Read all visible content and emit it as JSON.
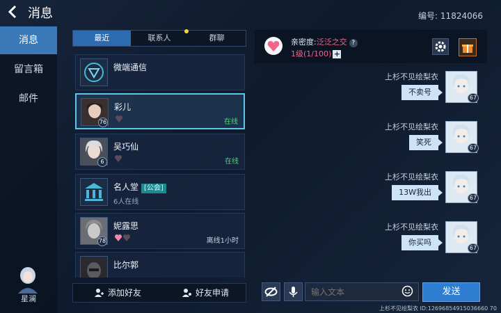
{
  "header": {
    "title": "消息",
    "uid_label": "编号:",
    "uid_value": "11824066"
  },
  "nav": {
    "items": [
      "消息",
      "留言箱",
      "邮件"
    ],
    "me_name": "星澜"
  },
  "tabs": [
    "最近",
    "联系人",
    "群聊"
  ],
  "contacts": [
    {
      "name": "微端通信",
      "sub": "",
      "status": "",
      "level": ""
    },
    {
      "name": "彩儿",
      "sub": "",
      "status": "在线",
      "level": "76"
    },
    {
      "name": "吴巧仙",
      "sub": "",
      "status": "在线",
      "level": "6"
    },
    {
      "name": "名人堂",
      "tag": "[公会]",
      "sub": "6人在线",
      "status": "",
      "level": ""
    },
    {
      "name": "妮露思",
      "sub": "",
      "status": "离线1小时",
      "level": "78"
    },
    {
      "name": "比尔郭",
      "sub": "",
      "status": "",
      "level": ""
    }
  ],
  "bottom_buttons": {
    "add_friend": "添加好友",
    "friend_request": "好友申请"
  },
  "intimacy": {
    "label": "亲密度:",
    "value": "泛泛之交",
    "help": "?",
    "level": "1级(1/100)",
    "plus": "+"
  },
  "messages": [
    {
      "sender": "上杉不见绘梨衣",
      "text": "不卖号",
      "level": "67"
    },
    {
      "sender": "上杉不见绘梨衣",
      "text": "笑死",
      "level": "67"
    },
    {
      "sender": "上杉不见绘梨衣",
      "text": "13W我出",
      "level": "67"
    },
    {
      "sender": "上杉不见绘梨衣",
      "text": "你买吗",
      "level": "67"
    }
  ],
  "input": {
    "placeholder": "输入文本",
    "send_label": "发送"
  },
  "footer": "上杉不见绘梨衣 ID:12696854915036660 70",
  "colors": {
    "accent": "#2f7dd1",
    "online": "#52d17a",
    "intimacy": "#f3638a",
    "selected_border": "#5ec6e8"
  }
}
